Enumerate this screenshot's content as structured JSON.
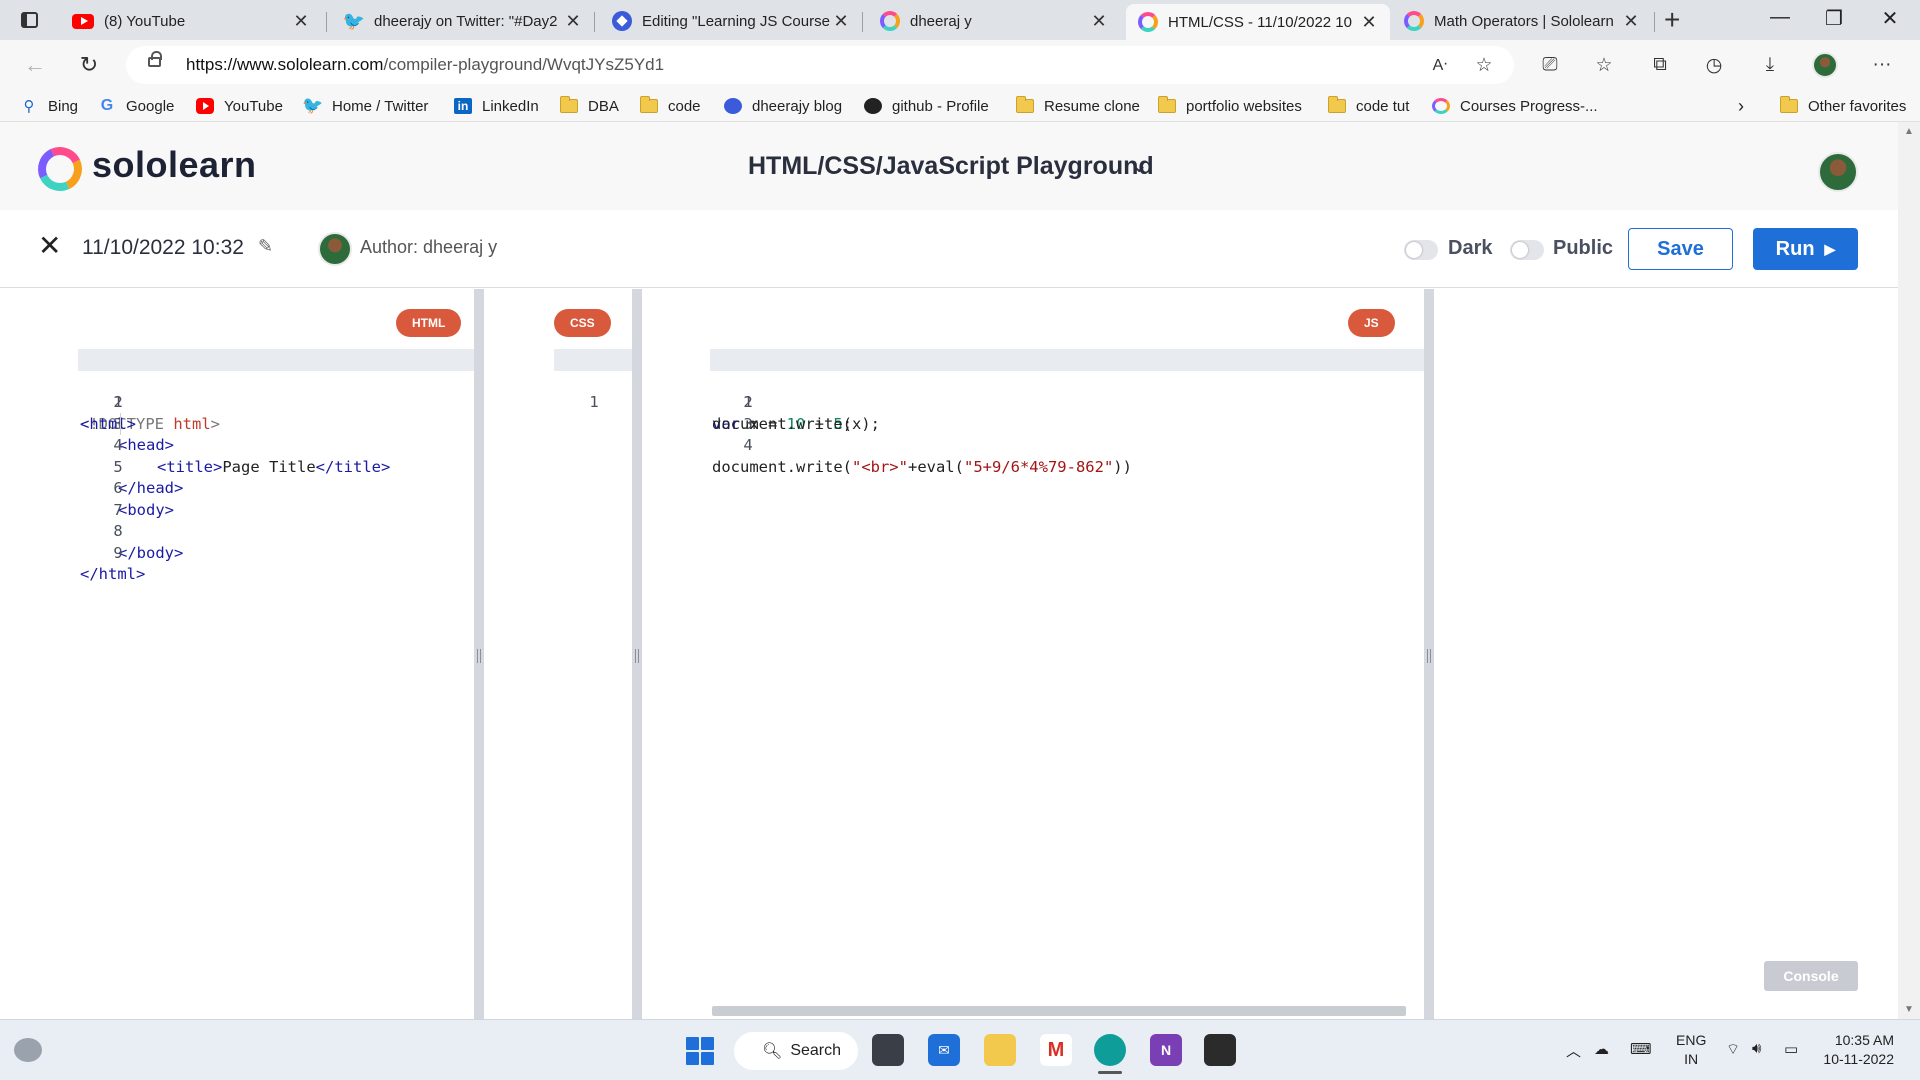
{
  "browser": {
    "tabs": [
      {
        "title": "(8) YouTube",
        "favicon": "youtube-icon"
      },
      {
        "title": "dheerajy on Twitter: \"#Day2",
        "favicon": "twitter-icon"
      },
      {
        "title": "Editing \"Learning JS Course",
        "favicon": "editor-icon"
      },
      {
        "title": "dheeraj y",
        "favicon": "sololearn-icon"
      },
      {
        "title": "HTML/CSS - 11/10/2022 10",
        "favicon": "sololearn-icon",
        "active": true
      },
      {
        "title": "Math Operators | Sololearn",
        "favicon": "sololearn-icon"
      }
    ],
    "url_host": "https://www.sololearn.com",
    "url_path": "/compiler-playground/WvqtJYsZ5Yd1",
    "bookmarks": [
      {
        "label": "Bing",
        "icon": "bing-icon"
      },
      {
        "label": "Google",
        "icon": "google-icon"
      },
      {
        "label": "YouTube",
        "icon": "youtube-icon"
      },
      {
        "label": "Home / Twitter",
        "icon": "twitter-icon"
      },
      {
        "label": "LinkedIn",
        "icon": "linkedin-icon"
      },
      {
        "label": "DBA",
        "icon": "folder-icon"
      },
      {
        "label": "code",
        "icon": "folder-icon"
      },
      {
        "label": "dheerajy blog",
        "icon": "blog-icon"
      },
      {
        "label": "github - Profile",
        "icon": "github-icon"
      },
      {
        "label": "Resume clone",
        "icon": "folder-icon"
      },
      {
        "label": "portfolio websites",
        "icon": "folder-icon"
      },
      {
        "label": "code tut",
        "icon": "folder-icon"
      },
      {
        "label": "Courses Progress-...",
        "icon": "sololearn-icon"
      }
    ],
    "other_favorites": "Other favorites"
  },
  "app": {
    "logo_text": "sololearn",
    "playground_title": "HTML/CSS/JavaScript Playground"
  },
  "toolbar": {
    "code_name": "11/10/2022 10:32",
    "author": "Author: dheeraj y",
    "dark_label": "Dark",
    "public_label": "Public",
    "save_label": "Save",
    "run_label": "Run"
  },
  "editors": {
    "html": {
      "badge": "HTML",
      "line_numbers": [
        "1",
        "2",
        "3",
        "4",
        "5",
        "6",
        "7",
        "8",
        "9"
      ]
    },
    "css": {
      "badge": "CSS",
      "line_numbers": [
        "1"
      ]
    },
    "js": {
      "badge": "JS",
      "line_numbers": [
        "1",
        "2",
        "3",
        "4"
      ]
    }
  },
  "console_label": "Console",
  "taskbar": {
    "search_label": "Search",
    "lang_line1": "ENG",
    "lang_line2": "IN",
    "time": "10:35 AM",
    "date": "10-11-2022"
  },
  "colors": {
    "accent_blue": "#1f6fd8",
    "badge_orange": "#d9593c",
    "divider_gray": "#d4d8de"
  }
}
